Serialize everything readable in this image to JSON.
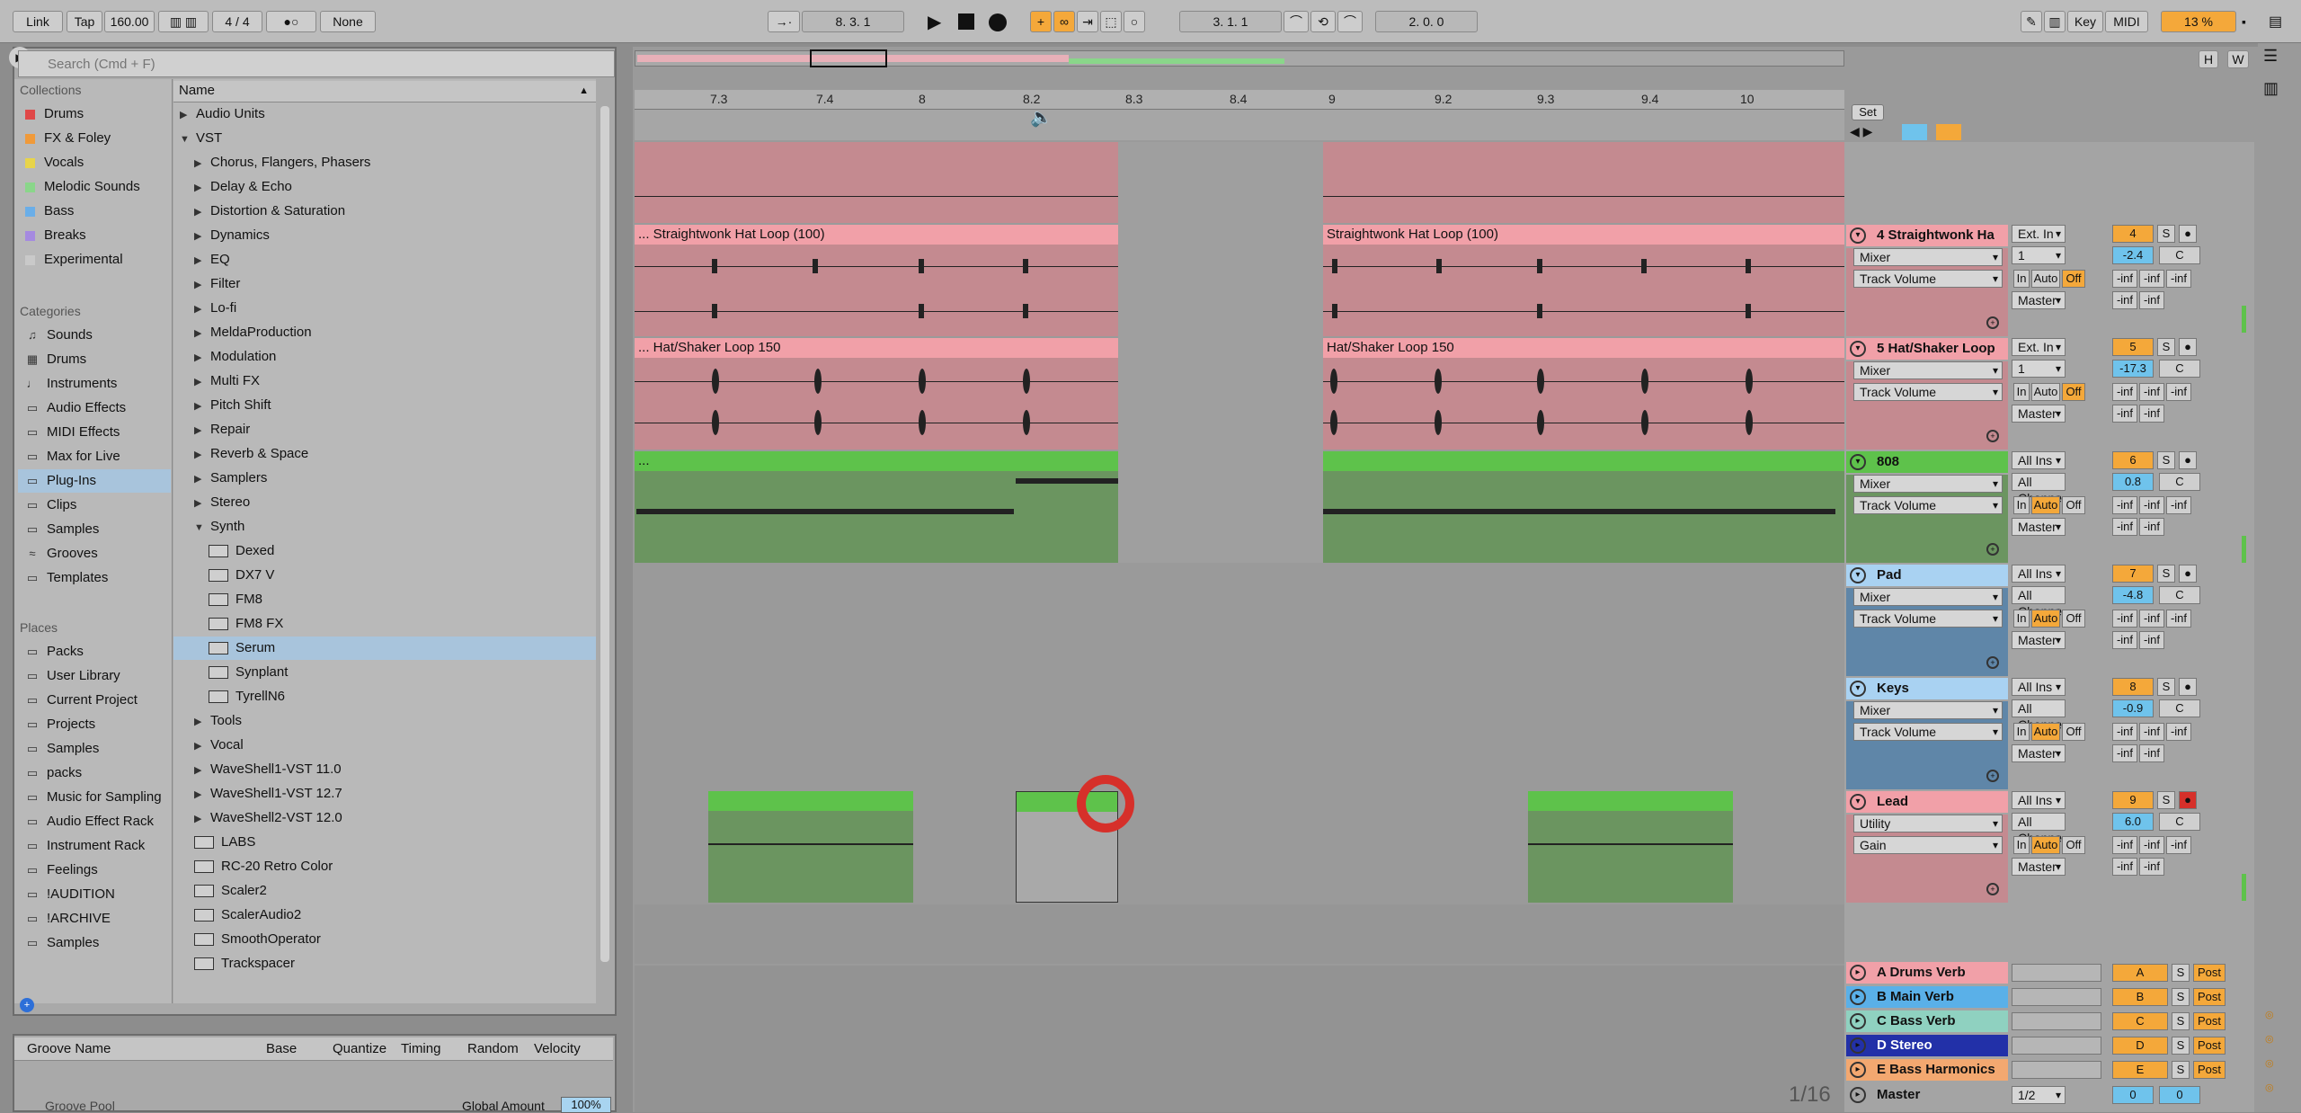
{
  "transport": {
    "link": "Link",
    "tap": "Tap",
    "tempo": "160.00",
    "signature": "4 / 4",
    "dots": "●○",
    "quantize": "None",
    "position": "8.   3.   1",
    "loop_start": "3.   1.   1",
    "loop_length": "2.   0.   0",
    "key": "Key",
    "midi": "MIDI",
    "cpu": "13 %"
  },
  "browser": {
    "search_placeholder": "Search (Cmd + F)",
    "collections_title": "Collections",
    "collections": [
      {
        "label": "Drums",
        "color": "#e04848"
      },
      {
        "label": "FX & Foley",
        "color": "#f09a3a"
      },
      {
        "label": "Vocals",
        "color": "#e8d44a"
      },
      {
        "label": "Melodic Sounds",
        "color": "#8ad68a"
      },
      {
        "label": "Bass",
        "color": "#6aaee8"
      },
      {
        "label": "Breaks",
        "color": "#a58ae0"
      },
      {
        "label": "Experimental",
        "color": "#c9c9c9"
      }
    ],
    "categories_title": "Categories",
    "categories": [
      "Sounds",
      "Drums",
      "Instruments",
      "Audio Effects",
      "MIDI Effects",
      "Max for Live",
      "Plug-Ins",
      "Clips",
      "Samples",
      "Grooves",
      "Templates"
    ],
    "places_title": "Places",
    "places": [
      "Packs",
      "User Library",
      "Current Project",
      "Projects",
      "Samples",
      "packs",
      "Music for Sampling",
      "Audio Effect Rack",
      "Instrument Rack",
      "Feelings",
      "!AUDITION",
      "!ARCHIVE",
      "Samples"
    ],
    "name_header": "Name",
    "tree": [
      {
        "label": "Audio Units",
        "type": "folder",
        "indent": 0
      },
      {
        "label": "VST",
        "type": "open",
        "indent": 0
      },
      {
        "label": "Chorus, Flangers, Phasers",
        "type": "folder",
        "indent": 1
      },
      {
        "label": "Delay & Echo",
        "type": "folder",
        "indent": 1
      },
      {
        "label": "Distortion & Saturation",
        "type": "folder",
        "indent": 1
      },
      {
        "label": "Dynamics",
        "type": "folder",
        "indent": 1
      },
      {
        "label": "EQ",
        "type": "folder",
        "indent": 1
      },
      {
        "label": "Filter",
        "type": "folder",
        "indent": 1
      },
      {
        "label": "Lo-fi",
        "type": "folder",
        "indent": 1
      },
      {
        "label": "MeldaProduction",
        "type": "folder",
        "indent": 1
      },
      {
        "label": "Modulation",
        "type": "folder",
        "indent": 1
      },
      {
        "label": "Multi FX",
        "type": "folder",
        "indent": 1
      },
      {
        "label": "Pitch Shift",
        "type": "folder",
        "indent": 1
      },
      {
        "label": "Repair",
        "type": "folder",
        "indent": 1
      },
      {
        "label": "Reverb & Space",
        "type": "folder",
        "indent": 1
      },
      {
        "label": "Samplers",
        "type": "folder",
        "indent": 1
      },
      {
        "label": "Stereo",
        "type": "folder",
        "indent": 1
      },
      {
        "label": "Synth",
        "type": "open",
        "indent": 1
      },
      {
        "label": "Dexed",
        "type": "plugin",
        "indent": 2
      },
      {
        "label": "DX7 V",
        "type": "plugin",
        "indent": 2
      },
      {
        "label": "FM8",
        "type": "plugin",
        "indent": 2
      },
      {
        "label": "FM8 FX",
        "type": "plugin",
        "indent": 2
      },
      {
        "label": "Serum",
        "type": "plugin",
        "indent": 2,
        "selected": true
      },
      {
        "label": "Synplant",
        "type": "plugin",
        "indent": 2
      },
      {
        "label": "TyrellN6",
        "type": "plugin",
        "indent": 2
      },
      {
        "label": "Tools",
        "type": "folder",
        "indent": 1
      },
      {
        "label": "Vocal",
        "type": "folder",
        "indent": 1
      },
      {
        "label": "WaveShell1-VST 11.0",
        "type": "folder",
        "indent": 1
      },
      {
        "label": "WaveShell1-VST 12.7",
        "type": "folder",
        "indent": 1
      },
      {
        "label": "WaveShell2-VST 12.0",
        "type": "folder",
        "indent": 1
      },
      {
        "label": "LABS",
        "type": "plugin",
        "indent": 1
      },
      {
        "label": "RC-20 Retro Color",
        "type": "plugin",
        "indent": 1
      },
      {
        "label": "Scaler2",
        "type": "plugin",
        "indent": 1
      },
      {
        "label": "ScalerAudio2",
        "type": "plugin",
        "indent": 1
      },
      {
        "label": "SmoothOperator",
        "type": "plugin",
        "indent": 1
      },
      {
        "label": "Trackspacer",
        "type": "plugin",
        "indent": 1
      }
    ]
  },
  "groove": {
    "headers": [
      "Groove Name",
      "Base",
      "Quantize",
      "Timing",
      "Random",
      "Velocity"
    ],
    "pool_label": "Groove Pool",
    "global_label": "Global Amount",
    "global_value": "100%"
  },
  "ruler": [
    "7.3",
    "7.4",
    "8",
    "8.2",
    "8.3",
    "8.4",
    "9",
    "9.2",
    "9.3",
    "9.4",
    "10"
  ],
  "set_label": "Set",
  "clips": {
    "hat1a": "... Straightwonk Hat Loop (100)",
    "hat1b": "Straightwonk Hat Loop (100)",
    "hat2a": "... Hat/Shaker Loop 150",
    "hat2b": "Hat/Shaker Loop 150",
    "bass": "..."
  },
  "tracks": [
    {
      "name": "4 Straightwonk Ha",
      "input": "Ext. In",
      "num": "4",
      "vol": "-2.4",
      "pan": "C",
      "ch": "1",
      "color": "#f1a0a8"
    },
    {
      "name": "5 Hat/Shaker Loop",
      "input": "Ext. In",
      "num": "5",
      "vol": "-17.3",
      "pan": "C",
      "ch": "1",
      "color": "#f1a0a8"
    },
    {
      "name": "808",
      "input": "All Ins",
      "num": "6",
      "vol": "0.8",
      "pan": "C",
      "ch": "All Channe",
      "color": "#5ec24b"
    },
    {
      "name": "Pad",
      "input": "All Ins",
      "num": "7",
      "vol": "-4.8",
      "pan": "C",
      "ch": "All Channe",
      "color": "#a9d2f2"
    },
    {
      "name": "Keys",
      "input": "All Ins",
      "num": "8",
      "vol": "-0.9",
      "pan": "C",
      "ch": "All Channe",
      "color": "#a9d2f2"
    },
    {
      "name": "Lead",
      "input": "All Ins",
      "num": "9",
      "vol": "6.0",
      "pan": "C",
      "ch": "All Channe",
      "color": "#f1a0a8"
    }
  ],
  "devices": {
    "mixer": "Mixer",
    "utility": "Utility",
    "track_volume": "Track Volume",
    "gain": "Gain",
    "master": "Master",
    "in": "In",
    "auto": "Auto",
    "off": "Off",
    "inf": "-inf",
    "s": "S",
    "post": "Post"
  },
  "returns": [
    {
      "name": "A Drums Verb",
      "letter": "A",
      "color": "#f1a0a8"
    },
    {
      "name": "B Main Verb",
      "letter": "B",
      "color": "#5ab0e8"
    },
    {
      "name": "C Bass Verb",
      "letter": "C",
      "color": "#8fd1c0"
    },
    {
      "name": "D Stereo",
      "letter": "D",
      "color": "#2230a8"
    },
    {
      "name": "E Bass Harmonics",
      "letter": "E",
      "color": "#f3a870"
    }
  ],
  "master": {
    "name": "Master",
    "route": "1/2",
    "vol": "0",
    "pan": "0"
  },
  "grid_label": "1/16",
  "side_buttons": [
    "H",
    "W"
  ]
}
